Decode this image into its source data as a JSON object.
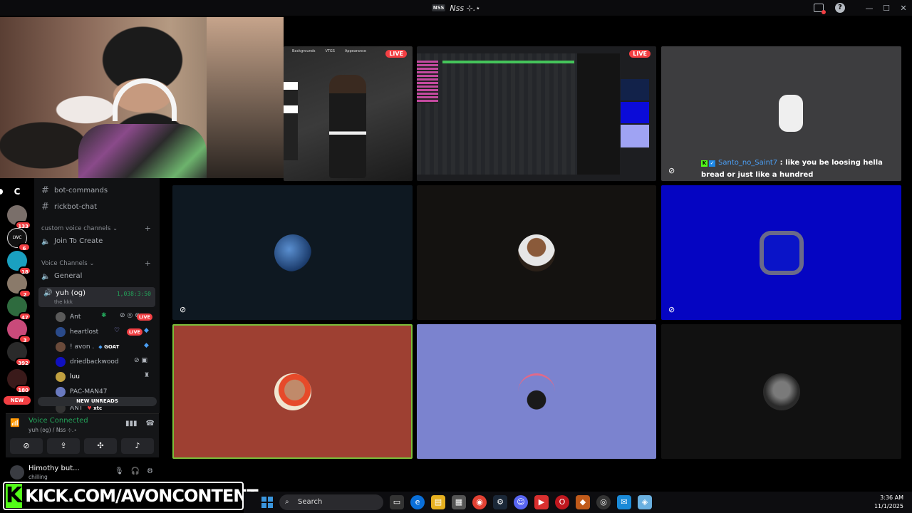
{
  "window": {
    "title": "Nss ⊹.⋆",
    "title_badge": "NSS"
  },
  "server_rail": {
    "current_initial": "C",
    "servers": [
      {
        "name": "server-1",
        "color": "#7a6f6a",
        "count": "133"
      },
      {
        "name": "server-lwc",
        "color": "#111111",
        "count": "6",
        "label": "LWC"
      },
      {
        "name": "server-3",
        "color": "#1aa0c0",
        "count": "18"
      },
      {
        "name": "server-4",
        "color": "#8a7a6a",
        "count": "2"
      },
      {
        "name": "server-5",
        "color": "#2e6b3e",
        "count": "47"
      },
      {
        "name": "server-6",
        "color": "#c94a7a",
        "count": "3"
      },
      {
        "name": "server-7",
        "color": "#2a2a2a",
        "count": "392"
      },
      {
        "name": "server-8",
        "color": "#3a1a1a",
        "count": "180"
      }
    ],
    "new_label": "NEW"
  },
  "channels": {
    "text": [
      "bot-commands",
      "rickbot-chat"
    ],
    "custom_category": "custom voice channels",
    "join_to_create": "Join To Create",
    "voice_category": "Voice Channels",
    "general": "General",
    "active_voice": {
      "name": "yuh (og)",
      "subtitle": "the kkk",
      "timer": "1,038:3:50"
    },
    "members": [
      {
        "name": "Ant",
        "live": "LIVE",
        "color": "#5a5a5a"
      },
      {
        "name": "heartlost",
        "live": "LIVE",
        "color": "#2a4a8a"
      },
      {
        "name": "! avon .",
        "tag": "GOAT",
        "color": "#6a4a3a"
      },
      {
        "name": "driedbackwood",
        "color": "#1010c0"
      },
      {
        "name": "luu",
        "color": "#c0a040"
      },
      {
        "name": "PAC-MAN47",
        "color": "#6a7ac0"
      },
      {
        "name": "ANT",
        "tag": "xtc",
        "color": "#333"
      }
    ],
    "new_unreads": "NEW UNREADS"
  },
  "voice_panel": {
    "status": "Voice Connected",
    "location": "yuh (og) / Nss ⊹.⋆"
  },
  "user_panel": {
    "name": "Himothy but...",
    "status": "chilling"
  },
  "kick_banner": {
    "logo": "K",
    "text": "KICK.COM/AVONCONTENT"
  },
  "grid": {
    "live_label": "LIVE",
    "game_menu": [
      "Backgrounds",
      "VTGS",
      "Appearance"
    ],
    "chat_overlay": {
      "user": "Santo_no_Saint7",
      "message": ": like you be loosing hella bread or just like a hundred"
    }
  },
  "taskbar": {
    "search_placeholder": "Search",
    "time": "3:36 AM",
    "date": "11/1/2025"
  }
}
